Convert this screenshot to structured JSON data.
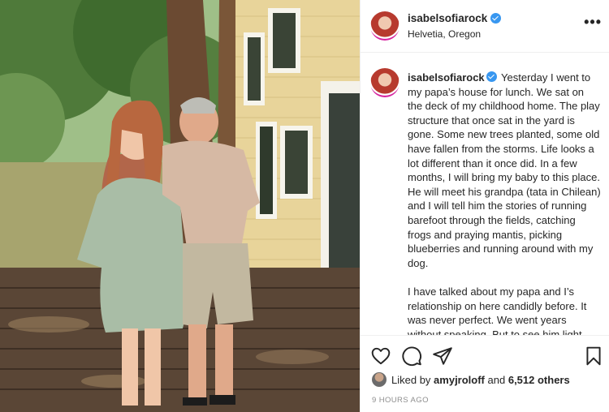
{
  "post": {
    "username": "isabelsofiarock",
    "location": "Helvetia, Oregon",
    "more_label": "•••",
    "caption": {
      "username": "isabelsofiarock",
      "paragraph1": "Yesterday I went to my papa’s house for lunch. We sat on the deck of my childhood home. The play structure that once sat in the yard is gone. Some new trees planted, some old have fallen from the storms. Life looks a lot different than it once did. In a few months, I will bring my baby to this place. He will meet his grandpa (tata in Chilean) and I will tell him the stories of running barefoot through the fields, catching frogs and praying mantis, picking blueberries and running around with my dog.",
      "paragraph2": "I have talked about my papa and I’s relationship on here candidly before. It was never perfect. We went years without speaking. But to see him light"
    },
    "likes": {
      "prefix": "Liked by",
      "user": "amyjroloff",
      "joiner": "and",
      "others": "6,512 others"
    },
    "timestamp": "9 HOURS AGO"
  },
  "icons": [
    "heart-icon",
    "comment-icon",
    "share-icon",
    "bookmark-icon",
    "verified-badge-icon",
    "more-options-icon"
  ],
  "colors": {
    "verified": "#3897f0",
    "text": "#262626",
    "muted": "#8e8e8e",
    "border": "#efefef"
  }
}
